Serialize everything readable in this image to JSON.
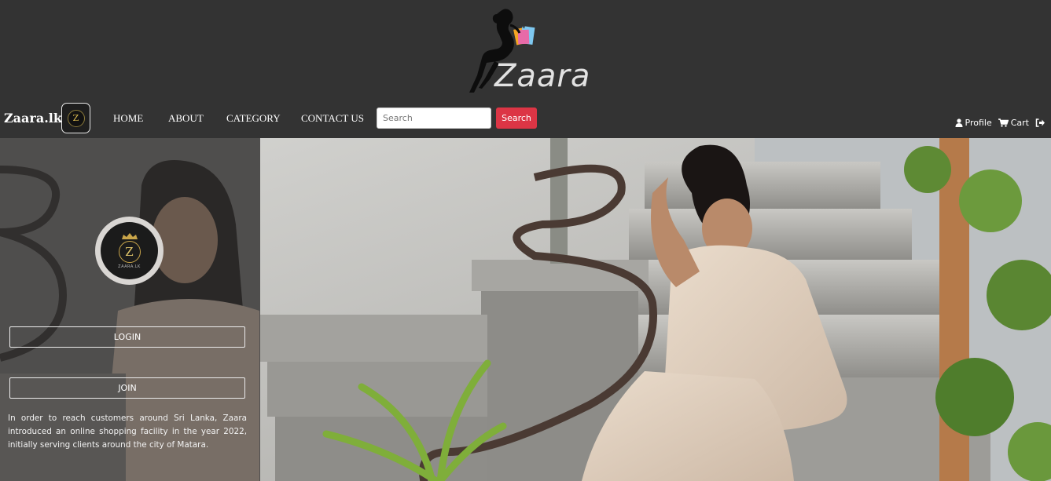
{
  "header": {
    "logo_text": "Zaara",
    "logo_icon": "woman-with-shopping-bags-logo"
  },
  "navbar": {
    "brand": "Zaara.lk",
    "badge_letter": "Z",
    "links": {
      "home": "HOME",
      "about": "ABOUT",
      "category": "CATEGORY",
      "contact": "CONTACT US"
    },
    "search": {
      "placeholder": "Search",
      "button_label": "Search"
    },
    "right": {
      "profile_label": "Profile",
      "cart_label": "Cart"
    }
  },
  "panel": {
    "logo_letter": "Z",
    "logo_caption": "ZAARA.LK",
    "login_label": "LOGIN",
    "join_label": "JOIN",
    "description": "In order to reach customers around Sri Lanka, Zaara introduced an online shopping facility in the year 2022, initially serving clients around the city of Matara."
  },
  "colors": {
    "background": "#333333",
    "search_button": "#dc3545",
    "gold": "#c9a54a"
  }
}
